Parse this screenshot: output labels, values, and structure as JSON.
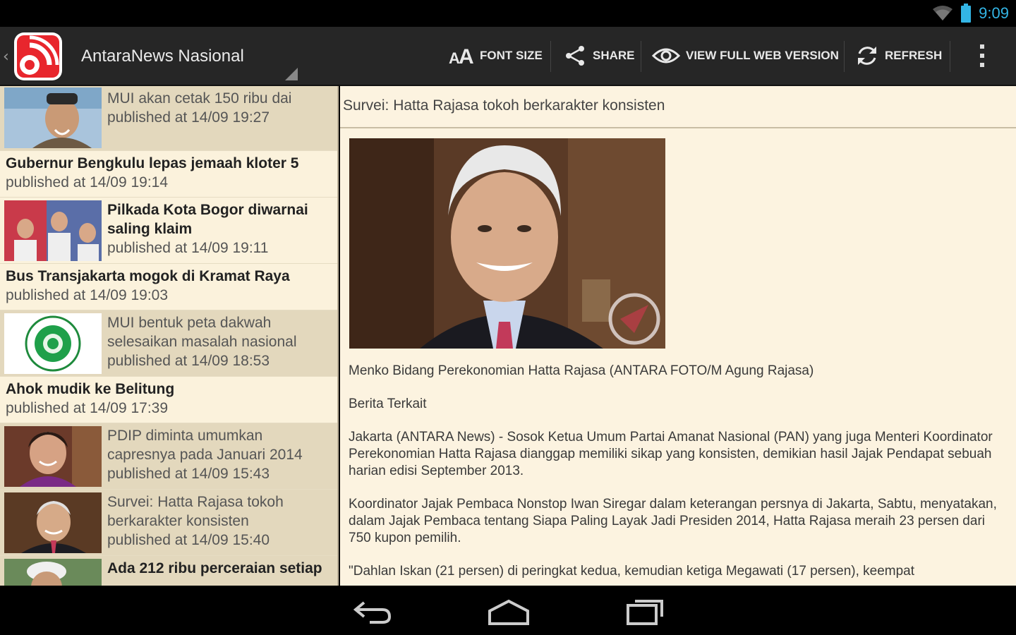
{
  "status": {
    "time": "9:09",
    "icons": [
      "wifi-icon",
      "battery-icon"
    ]
  },
  "actionbar": {
    "title": "AntaraNews Nasional",
    "actions": [
      {
        "icon": "font-size-icon",
        "label": "FONT SIZE"
      },
      {
        "icon": "share-icon",
        "label": "SHARE"
      },
      {
        "icon": "eye-icon",
        "label": "VIEW FULL WEB VERSION"
      },
      {
        "icon": "refresh-icon",
        "label": "REFRESH"
      },
      {
        "icon": "overflow-menu-icon",
        "label": ""
      }
    ],
    "colors": {
      "logo": "#e8262d"
    }
  },
  "articles": [
    {
      "title": "MUI akan cetak 150 ribu dai",
      "published": "published at 14/09 19:27",
      "has_image": true
    },
    {
      "title": "Gubernur Bengkulu lepas jemaah kloter 5",
      "published": "published at 14/09 19:14",
      "has_image": false
    },
    {
      "title": "Pilkada Kota Bogor diwarnai saling klaim",
      "published": "published at 14/09 19:11",
      "has_image": true
    },
    {
      "title": "Bus Transjakarta mogok di Kramat Raya",
      "published": "published at 14/09 19:03",
      "has_image": false
    },
    {
      "title": "MUI bentuk peta dakwah selesaikan masalah nasional",
      "published": "published at 14/09 18:53",
      "has_image": true
    },
    {
      "title": "Ahok mudik ke Belitung",
      "published": "published at 14/09 17:39",
      "has_image": false
    },
    {
      "title": "PDIP diminta umumkan capresnya pada Januari 2014",
      "published": "published at 14/09 15:43",
      "has_image": true
    },
    {
      "title": "Survei: Hatta Rajasa tokoh berkarakter konsisten",
      "published": "published at 14/09 15:40",
      "has_image": true
    },
    {
      "title": "Ada 212 ribu perceraian setiap",
      "published": "",
      "has_image": true
    }
  ],
  "detail": {
    "title": "Survei: Hatta Rajasa tokoh berkarakter konsisten",
    "caption": "Menko Bidang Perekonomian Hatta Rajasa (ANTARA FOTO/M Agung Rajasa)",
    "related": "Berita Terkait",
    "p1": "Jakarta (ANTARA News) - Sosok Ketua Umum Partai Amanat Nasional (PAN) yang juga Menteri Koordinator Perekonomian Hatta Rajasa dianggap memiliki sikap yang konsisten, demikian hasil Jajak Pendapat sebuah harian edisi September 2013.",
    "p2": "Koordinator Jajak Pembaca Nonstop Iwan Siregar dalam keterangan persnya di Jakarta, Sabtu, menyatakan, dalam Jajak Pembaca tentang Siapa Paling Layak Jadi Presiden 2014, Hatta Rajasa meraih 23 persen dari 750 kupon pemilih.",
    "p3": "\"Dahlan Iskan (21 persen) di peringkat kedua, kemudian ketiga Megawati (17 persen), keempat"
  },
  "navbar": {
    "icons": [
      "back-icon",
      "home-icon",
      "recent-apps-icon"
    ]
  }
}
